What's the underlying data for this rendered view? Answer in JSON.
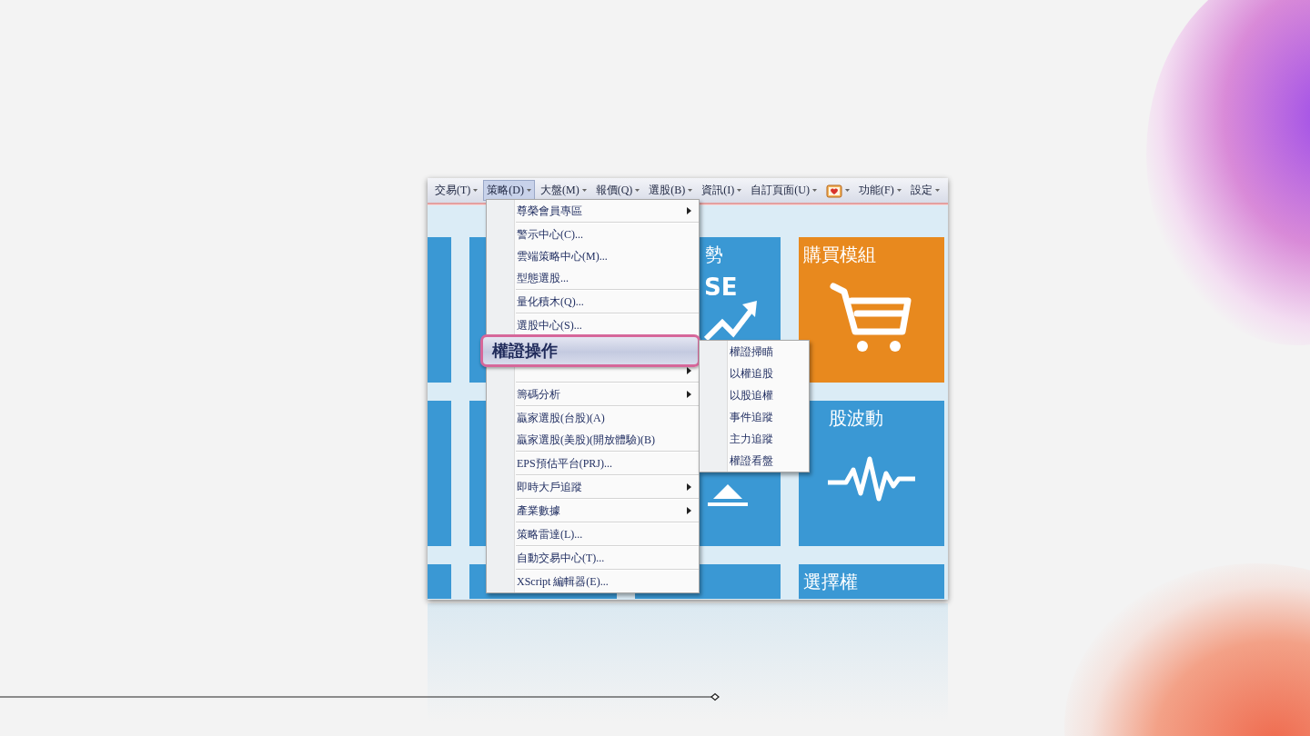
{
  "menubar": {
    "items": [
      {
        "label": "交易(T)",
        "selected": false,
        "kind": "text"
      },
      {
        "label": "策略(D)",
        "selected": true,
        "kind": "text"
      },
      {
        "label": "大盤(M)",
        "selected": false,
        "kind": "text"
      },
      {
        "label": "報價(Q)",
        "selected": false,
        "kind": "text"
      },
      {
        "label": "選股(B)",
        "selected": false,
        "kind": "text"
      },
      {
        "label": "資訊(I)",
        "selected": false,
        "kind": "text"
      },
      {
        "label": "自訂頁面(U)",
        "selected": false,
        "kind": "text"
      },
      {
        "selected": false,
        "kind": "icon"
      },
      {
        "label": "功能(F)",
        "selected": false,
        "kind": "text"
      },
      {
        "label": "設定",
        "selected": false,
        "kind": "text"
      }
    ]
  },
  "tiles": [
    {
      "kind": "plain",
      "color": "#3a98d4"
    },
    {
      "kind": "plain",
      "color": "#3a98d4"
    },
    {
      "kind": "trend",
      "title": "勢",
      "logo": "SE",
      "color": "#3a98d4"
    },
    {
      "kind": "cart",
      "title": "購買模組",
      "color": "#e8891e"
    },
    {
      "kind": "plain",
      "color": "#3a98d4"
    },
    {
      "kind": "plain",
      "color": "#3a98d4"
    },
    {
      "kind": "dome",
      "color": "#3a98d4"
    },
    {
      "kind": "pulse",
      "title": "股波動",
      "color": "#3a98d4"
    },
    {
      "kind": "plain",
      "color": "#3a98d4"
    },
    {
      "kind": "plain",
      "color": "#3a98d4"
    },
    {
      "kind": "plain",
      "color": "#3a98d4"
    },
    {
      "kind": "plain",
      "title": "選擇權",
      "color": "#3a98d4"
    }
  ],
  "dropdown_menu": {
    "groups": [
      [
        {
          "kind": "entry",
          "label": "尊榮會員專區",
          "submenu": true
        }
      ],
      [
        {
          "kind": "entry",
          "label": "警示中心(C)...",
          "submenu": false
        },
        {
          "kind": "entry",
          "label": "雲端策略中心(M)...",
          "submenu": false
        },
        {
          "kind": "entry",
          "label": "型態選股...",
          "submenu": false
        }
      ],
      [
        {
          "kind": "entry",
          "label": "量化積木(Q)...",
          "submenu": false
        }
      ],
      [
        {
          "kind": "entry",
          "label": "選股中心(S)...",
          "submenu": false
        }
      ],
      [
        {
          "kind": "covered"
        },
        {
          "kind": "covered",
          "submenu": true
        }
      ],
      [
        {
          "kind": "entry",
          "label": "籌碼分析",
          "submenu": true
        }
      ],
      [
        {
          "kind": "entry",
          "label": "贏家選股(台股)(A)",
          "submenu": false
        },
        {
          "kind": "entry",
          "label": "贏家選股(美股)(開放體驗)(B)",
          "submenu": false
        }
      ],
      [
        {
          "kind": "entry",
          "label": "EPS預估平台(PRJ)...",
          "submenu": false
        }
      ],
      [
        {
          "kind": "entry",
          "label": "即時大戶追蹤",
          "submenu": true
        }
      ],
      [
        {
          "kind": "entry",
          "label": "產業數據",
          "submenu": true
        }
      ],
      [
        {
          "kind": "entry",
          "label": "策略雷達(L)...",
          "submenu": false
        }
      ],
      [
        {
          "kind": "entry",
          "label": "自動交易中心(T)...",
          "submenu": false
        }
      ],
      [
        {
          "kind": "entry",
          "label": "XScript 編輯器(E)...",
          "submenu": false
        }
      ]
    ]
  },
  "callout": {
    "label": "權證操作"
  },
  "submenu": {
    "groups": [
      [
        {
          "kind": "entry",
          "label": "權證掃瞄",
          "submenu": false
        },
        {
          "kind": "entry",
          "label": "以權追股",
          "submenu": false
        },
        {
          "kind": "entry",
          "label": "以股追權",
          "submenu": false
        },
        {
          "kind": "entry",
          "label": "事件追蹤",
          "submenu": false
        },
        {
          "kind": "entry",
          "label": "主力追蹤",
          "submenu": false
        },
        {
          "kind": "entry",
          "label": "權證看盤",
          "submenu": false
        }
      ]
    ]
  }
}
